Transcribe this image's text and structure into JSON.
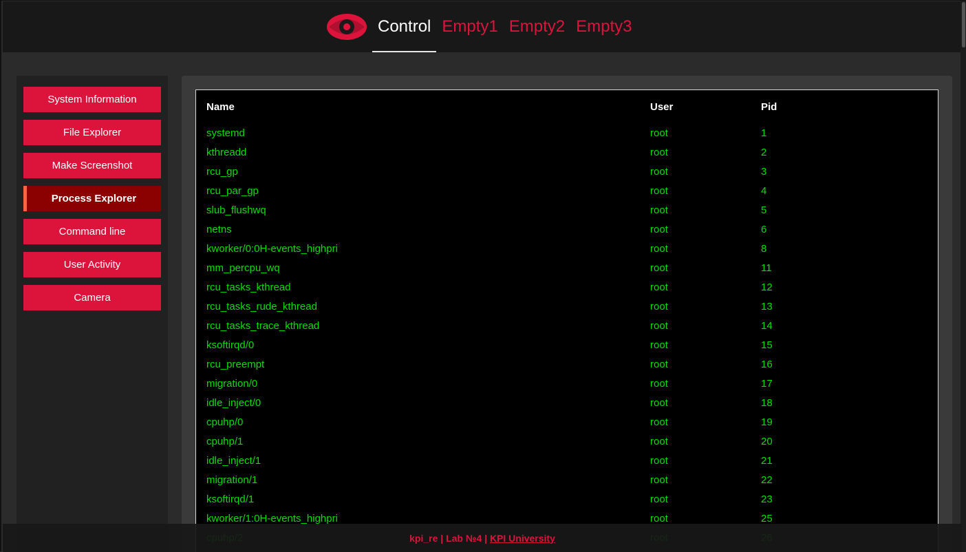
{
  "header": {
    "tabs": [
      {
        "label": "Control",
        "active": true
      },
      {
        "label": "Empty1",
        "active": false
      },
      {
        "label": "Empty2",
        "active": false
      },
      {
        "label": "Empty3",
        "active": false
      }
    ],
    "logo_icon": "eye-icon"
  },
  "sidebar": {
    "items": [
      {
        "label": "System Information"
      },
      {
        "label": "File Explorer"
      },
      {
        "label": "Make Screenshot"
      },
      {
        "label": "Process Explorer",
        "active": true
      },
      {
        "label": "Command line"
      },
      {
        "label": "User Activity"
      },
      {
        "label": "Camera"
      }
    ]
  },
  "table": {
    "headers": {
      "name": "Name",
      "user": "User",
      "pid": "Pid"
    },
    "rows": [
      {
        "name": "systemd",
        "user": "root",
        "pid": "1"
      },
      {
        "name": "kthreadd",
        "user": "root",
        "pid": "2"
      },
      {
        "name": "rcu_gp",
        "user": "root",
        "pid": "3"
      },
      {
        "name": "rcu_par_gp",
        "user": "root",
        "pid": "4"
      },
      {
        "name": "slub_flushwq",
        "user": "root",
        "pid": "5"
      },
      {
        "name": "netns",
        "user": "root",
        "pid": "6"
      },
      {
        "name": "kworker/0:0H-events_highpri",
        "user": "root",
        "pid": "8"
      },
      {
        "name": "mm_percpu_wq",
        "user": "root",
        "pid": "11"
      },
      {
        "name": "rcu_tasks_kthread",
        "user": "root",
        "pid": "12"
      },
      {
        "name": "rcu_tasks_rude_kthread",
        "user": "root",
        "pid": "13"
      },
      {
        "name": "rcu_tasks_trace_kthread",
        "user": "root",
        "pid": "14"
      },
      {
        "name": "ksoftirqd/0",
        "user": "root",
        "pid": "15"
      },
      {
        "name": "rcu_preempt",
        "user": "root",
        "pid": "16"
      },
      {
        "name": "migration/0",
        "user": "root",
        "pid": "17"
      },
      {
        "name": "idle_inject/0",
        "user": "root",
        "pid": "18"
      },
      {
        "name": "cpuhp/0",
        "user": "root",
        "pid": "19"
      },
      {
        "name": "cpuhp/1",
        "user": "root",
        "pid": "20"
      },
      {
        "name": "idle_inject/1",
        "user": "root",
        "pid": "21"
      },
      {
        "name": "migration/1",
        "user": "root",
        "pid": "22"
      },
      {
        "name": "ksoftirqd/1",
        "user": "root",
        "pid": "23"
      },
      {
        "name": "kworker/1:0H-events_highpri",
        "user": "root",
        "pid": "25"
      },
      {
        "name": "cpuhp/2",
        "user": "root",
        "pid": "26"
      }
    ]
  },
  "footer": {
    "prefix": "kpi_re | Lab №4 | ",
    "link": "KPI University"
  },
  "colors": {
    "accent": "#dc143c",
    "active_sidebar": "#8b0000",
    "active_marker": "#ff6347",
    "table_text": "#00e000",
    "background": "#2b2b2b"
  }
}
